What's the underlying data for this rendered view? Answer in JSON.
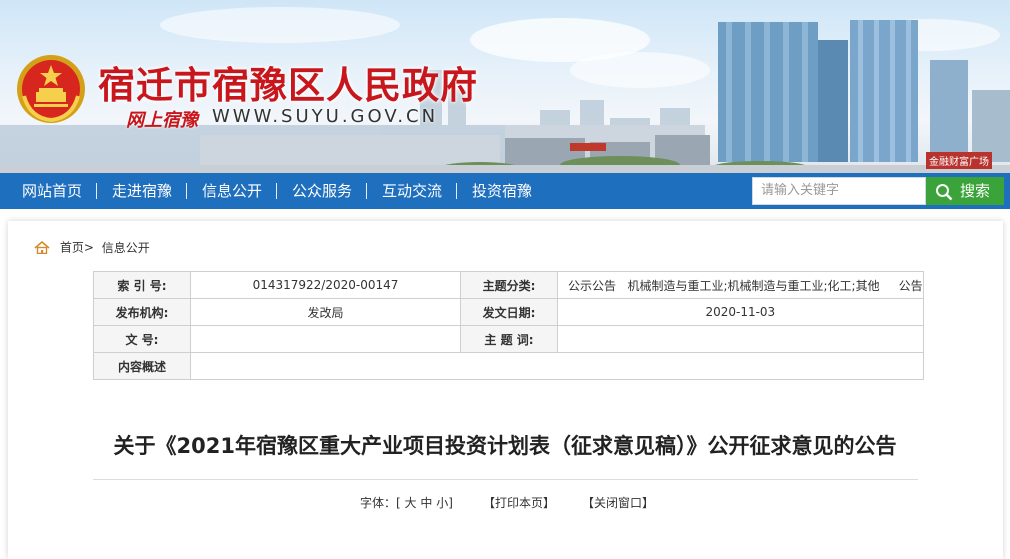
{
  "header": {
    "site_title": "宿迁市宿豫区人民政府",
    "slogan": "网上宿豫",
    "domain": "WWW.SUYU.GOV.CN",
    "building_sign": "金融财富广场"
  },
  "nav": {
    "items": [
      {
        "label": "网站首页"
      },
      {
        "label": "走进宿豫"
      },
      {
        "label": "信息公开"
      },
      {
        "label": "公众服务"
      },
      {
        "label": "互动交流"
      },
      {
        "label": "投资宿豫"
      }
    ],
    "search_placeholder": "请输入关键字",
    "search_button": "搜索"
  },
  "breadcrumb": {
    "home": "首页",
    "sep": ">",
    "current": "信息公开"
  },
  "info_table": {
    "index_label": "索 引 号:",
    "index_value": "014317922/2020-00147",
    "category_label": "主题分类:",
    "category_value": "公示公告   机械制造与重工业;机械制造与重工业;化工;其他     公告",
    "issuer_label": "发布机构:",
    "issuer_value": "发改局",
    "date_label": "发文日期:",
    "date_value": "2020-11-03",
    "docno_label": "文 号:",
    "docno_value": "",
    "keywords_label": "主 题 词:",
    "keywords_value": "",
    "summary_label": "内容概述",
    "summary_value": ""
  },
  "article": {
    "title": "关于《2021年宿豫区重大产业项目投资计划表（征求意见稿）》公开征求意见的公告"
  },
  "tools": {
    "font_label": "字体：[",
    "font_large": "大",
    "font_medium": "中",
    "font_small": "小",
    "font_close": "]",
    "print": "【打印本页】",
    "close": "【关闭窗口】"
  },
  "colors": {
    "nav_bg": "#1f6fbf",
    "title_red": "#c8161d",
    "search_green": "#3aa33a"
  }
}
